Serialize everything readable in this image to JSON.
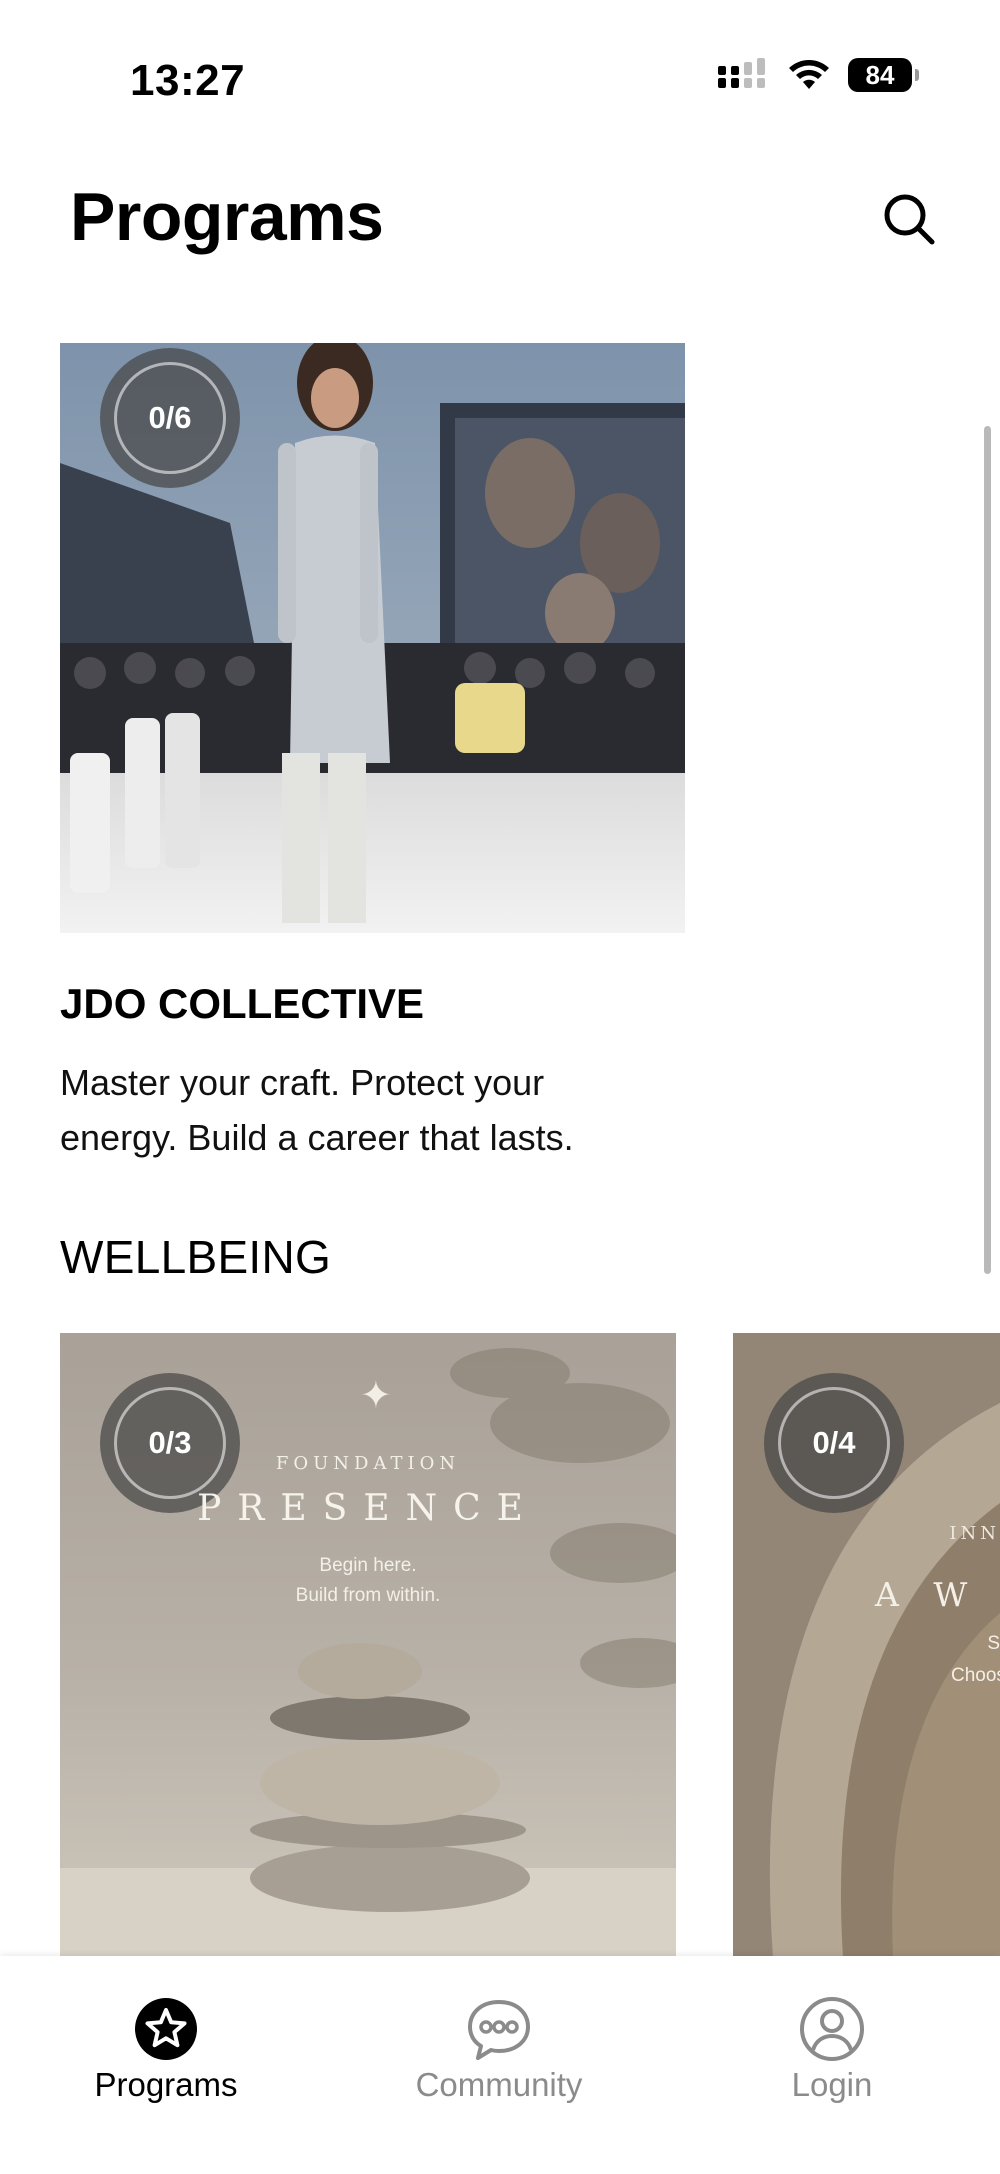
{
  "status_bar": {
    "time": "13:27",
    "battery": "84",
    "icons": [
      "cellular-signal-icon",
      "wifi-icon",
      "battery-icon"
    ]
  },
  "header": {
    "title": "Programs",
    "search_icon": "search-icon"
  },
  "featured": {
    "progress": "0/6",
    "title": "JDO COLLECTIVE",
    "description": "Master your craft. Protect your energy. Build a career that lasts."
  },
  "wellbeing": {
    "section_title": "WELLBEING",
    "cards": [
      {
        "progress": "0/3",
        "kicker": "FOUNDATION",
        "title": "PRESENCE",
        "subtitle_1": "Begin here.",
        "subtitle_2": "Build from within."
      },
      {
        "progress": "0/4",
        "kicker": "INN",
        "title": "A W A",
        "subtitle_1": "S",
        "subtitle_2": "Choos"
      }
    ]
  },
  "tabbar": {
    "tabs": [
      {
        "label": "Programs",
        "icon": "star-circle-icon",
        "active": true
      },
      {
        "label": "Community",
        "icon": "chat-bubble-icon",
        "active": false
      },
      {
        "label": "Login",
        "icon": "user-circle-icon",
        "active": false
      }
    ]
  },
  "colors": {
    "active_tab": "#000000",
    "inactive_tab": "#8b8b8b",
    "progress_badge": "#464646"
  }
}
